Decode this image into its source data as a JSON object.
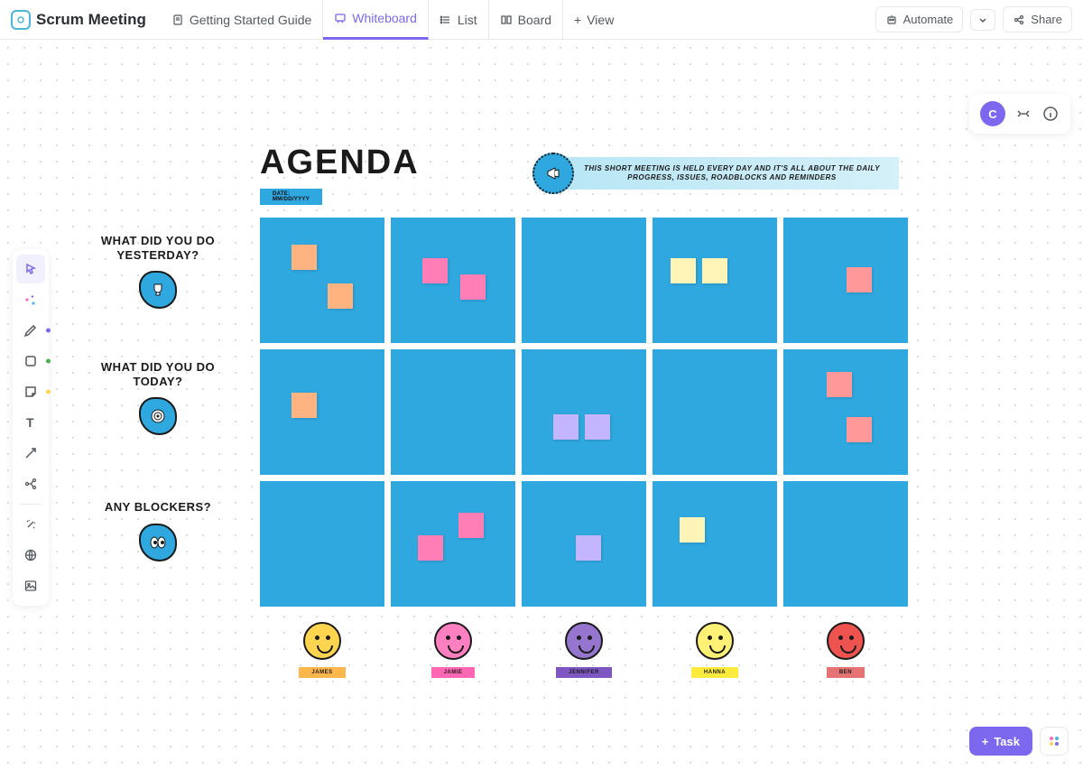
{
  "header": {
    "title": "Scrum Meeting",
    "tabs": [
      {
        "label": "Getting Started Guide",
        "icon": "doc"
      },
      {
        "label": "Whiteboard",
        "icon": "whiteboard",
        "active": true
      },
      {
        "label": "List",
        "icon": "list"
      },
      {
        "label": "Board",
        "icon": "board"
      }
    ],
    "view_label": "View",
    "automate_label": "Automate",
    "share_label": "Share"
  },
  "user": {
    "initial": "C"
  },
  "whiteboard": {
    "agenda_title": "AGENDA",
    "date_label": "DATE: MM/DD/YYYY",
    "banner_text": "This short meeting is held every day and it's all about the daily progress, issues, roadblocks and reminders",
    "rows": [
      {
        "label": "What did you do yesterday?"
      },
      {
        "label": "What did you do today?"
      },
      {
        "label": "Any blockers?"
      }
    ],
    "people": [
      {
        "name": "JAMES",
        "face": "#ffd54f",
        "tag": "#ffb74d"
      },
      {
        "name": "JAMIE",
        "face": "#ff80c0",
        "tag": "#ff66b3"
      },
      {
        "name": "JENNIFER",
        "face": "#9575cd",
        "tag": "#7e57c2"
      },
      {
        "name": "HANNA",
        "face": "#fff176",
        "tag": "#ffeb3b"
      },
      {
        "name": "BEN",
        "face": "#ef5350",
        "tag": "#e57373"
      }
    ],
    "stickies": {
      "r0c0": [
        {
          "x": 35,
          "y": 30,
          "c": "s-orange"
        },
        {
          "x": 75,
          "y": 73,
          "c": "s-orange"
        }
      ],
      "r0c1": [
        {
          "x": 35,
          "y": 45,
          "c": "s-pink"
        },
        {
          "x": 77,
          "y": 63,
          "c": "s-pink"
        }
      ],
      "r0c2": [],
      "r0c3": [
        {
          "x": 20,
          "y": 45,
          "c": "s-yellow"
        },
        {
          "x": 55,
          "y": 45,
          "c": "s-yellow"
        }
      ],
      "r0c4": [
        {
          "x": 70,
          "y": 55,
          "c": "s-coral"
        }
      ],
      "r1c0": [
        {
          "x": 35,
          "y": 48,
          "c": "s-orange"
        }
      ],
      "r1c1": [],
      "r1c2": [
        {
          "x": 35,
          "y": 72,
          "c": "s-purple"
        },
        {
          "x": 70,
          "y": 72,
          "c": "s-purple"
        }
      ],
      "r1c3": [],
      "r1c4": [
        {
          "x": 48,
          "y": 25,
          "c": "s-coral"
        },
        {
          "x": 70,
          "y": 75,
          "c": "s-coral"
        }
      ],
      "r2c0": [],
      "r2c1": [
        {
          "x": 30,
          "y": 60,
          "c": "s-pink"
        },
        {
          "x": 75,
          "y": 35,
          "c": "s-pink"
        }
      ],
      "r2c2": [
        {
          "x": 60,
          "y": 60,
          "c": "s-purple"
        }
      ],
      "r2c3": [
        {
          "x": 30,
          "y": 40,
          "c": "s-yellow"
        }
      ],
      "r2c4": []
    }
  },
  "task_button": "Task"
}
